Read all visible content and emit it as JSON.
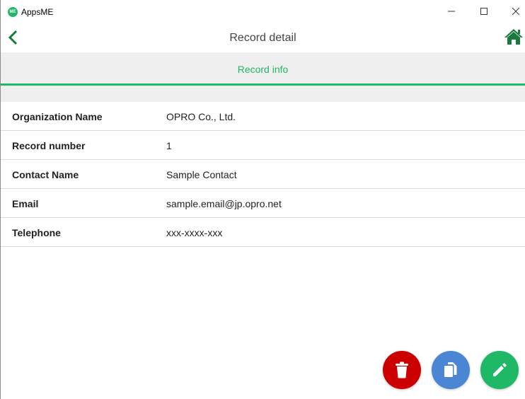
{
  "window": {
    "logo_text": "ME",
    "app_title": "AppsME",
    "controls": [
      "minimize-icon",
      "maximize-icon",
      "close-icon"
    ]
  },
  "header": {
    "back_icon": "chevron-left-icon",
    "title": "Record detail",
    "home_icon": "home-icon"
  },
  "tabs": [
    {
      "label": "Record info",
      "active": true
    }
  ],
  "fields": [
    {
      "label": "Organization Name",
      "value": "OPRO Co., Ltd."
    },
    {
      "label": "Record number",
      "value": "1"
    },
    {
      "label": "Contact Name",
      "value": "Sample Contact"
    },
    {
      "label": "Email",
      "value": "sample.email@jp.opro.net"
    },
    {
      "label": "Telephone",
      "value": "xxx-xxxx-xxx"
    }
  ],
  "actions": [
    {
      "name": "delete",
      "icon": "trash-icon",
      "color": "#cc0000"
    },
    {
      "name": "copy",
      "icon": "copy-icon",
      "color": "#4a86d4"
    },
    {
      "name": "edit",
      "icon": "pencil-icon",
      "color": "#1fb866"
    }
  ],
  "colors": {
    "accent": "#1fb866",
    "tab_background": "#efefef"
  }
}
